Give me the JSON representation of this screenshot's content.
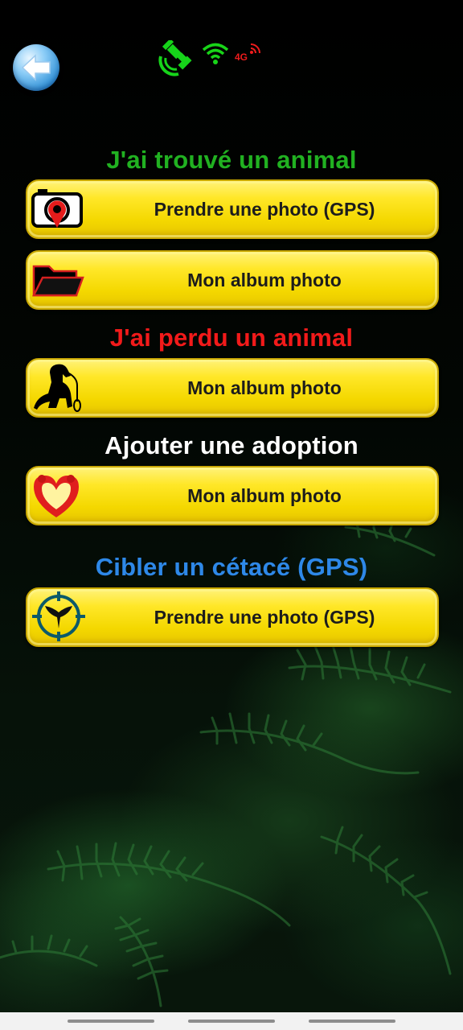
{
  "top_bar": {
    "back_icon": "back-arrow-icon",
    "status_icons": [
      "satellite-icon",
      "wifi-icon",
      "network-4g-icon"
    ],
    "network_label": "4G"
  },
  "sections": [
    {
      "heading": "J'ai trouvé un animal",
      "heading_color": "#21b121",
      "buttons": [
        {
          "label": "Prendre une photo (GPS)",
          "icon": "camera-gps-icon"
        },
        {
          "label": "Mon album photo",
          "icon": "folder-icon"
        }
      ]
    },
    {
      "heading": "J'ai perdu un animal",
      "heading_color": "#f21a1a",
      "buttons": [
        {
          "label": "Mon album photo",
          "icon": "dog-leash-icon"
        }
      ]
    },
    {
      "heading": "Ajouter une adoption",
      "heading_color": "#ffffff",
      "buttons": [
        {
          "label": "Mon album photo",
          "icon": "heart-icon"
        }
      ]
    },
    {
      "heading": "Cibler un cétacé (GPS)",
      "heading_color": "#2e88e8",
      "buttons": [
        {
          "label": "Prendre une photo (GPS)",
          "icon": "whale-tail-target-icon"
        }
      ]
    }
  ],
  "colors": {
    "button_yellow": "#ffe728",
    "background": "#000000"
  }
}
